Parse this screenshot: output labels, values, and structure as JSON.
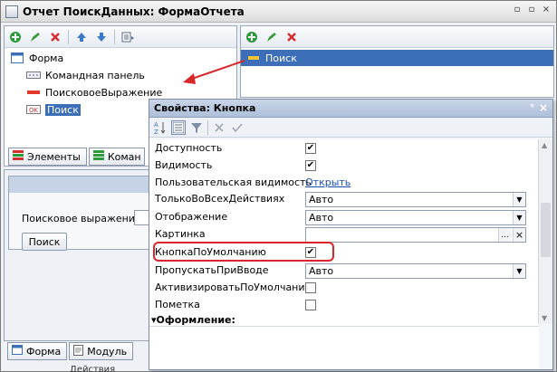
{
  "window": {
    "title": "Отчет ПоискДанных: ФормаОтчета",
    "buttons": [
      "▫",
      "▫",
      "×"
    ]
  },
  "elements_tree": {
    "items": [
      {
        "label": "Форма",
        "icon": "form-icon"
      },
      {
        "label": "Командная панель",
        "icon": "command-panel-icon"
      },
      {
        "label": "ПоисковоеВыражение",
        "icon": "input-field-icon"
      },
      {
        "label": "Поиск",
        "icon": "ok-button-icon",
        "selected": true
      }
    ],
    "tabs": [
      "Элементы",
      "Коман"
    ]
  },
  "commands_tree": {
    "items": [
      {
        "label": "Поиск",
        "icon": "command-icon",
        "selected": true
      }
    ]
  },
  "form_preview": {
    "search_label": "Поисковое выражение:",
    "search_button": "Поиск",
    "bottom_tabs": [
      "Форма",
      "Модуль"
    ],
    "bottom_cut": "Действия"
  },
  "properties": {
    "title": "Свойства: Кнопка",
    "pin": "ᵠ",
    "close": "×",
    "rows": [
      {
        "name": "Доступность",
        "type": "check",
        "checked": true
      },
      {
        "name": "Видимость",
        "type": "check",
        "checked": true
      },
      {
        "name": "Пользовательская видимость",
        "type": "link",
        "value": "Открыть"
      },
      {
        "name": "ТолькоВоВсехДействиях",
        "type": "select",
        "value": "Авто"
      },
      {
        "name": "Отображение",
        "type": "select",
        "value": "Авто"
      },
      {
        "name": "Картинка",
        "type": "picture",
        "value": "",
        "dots": "...",
        "clear": "×"
      },
      {
        "name": "КнопкаПоУмолчанию",
        "type": "check",
        "checked": true,
        "highlighted": true
      },
      {
        "name": "ПропускатьПриВводе",
        "type": "select",
        "value": "Авто"
      },
      {
        "name": "АктивизироватьПоУмолчанию",
        "type": "check",
        "checked": false
      },
      {
        "name": "Пометка",
        "type": "check",
        "checked": false
      }
    ],
    "group": "Оформление:",
    "check_mark": "✔",
    "dropdown_arrow": "▼",
    "colors": {
      "highlight": "#d8262a",
      "link": "#1a4fb3",
      "selection": "#3d6fb8"
    }
  }
}
